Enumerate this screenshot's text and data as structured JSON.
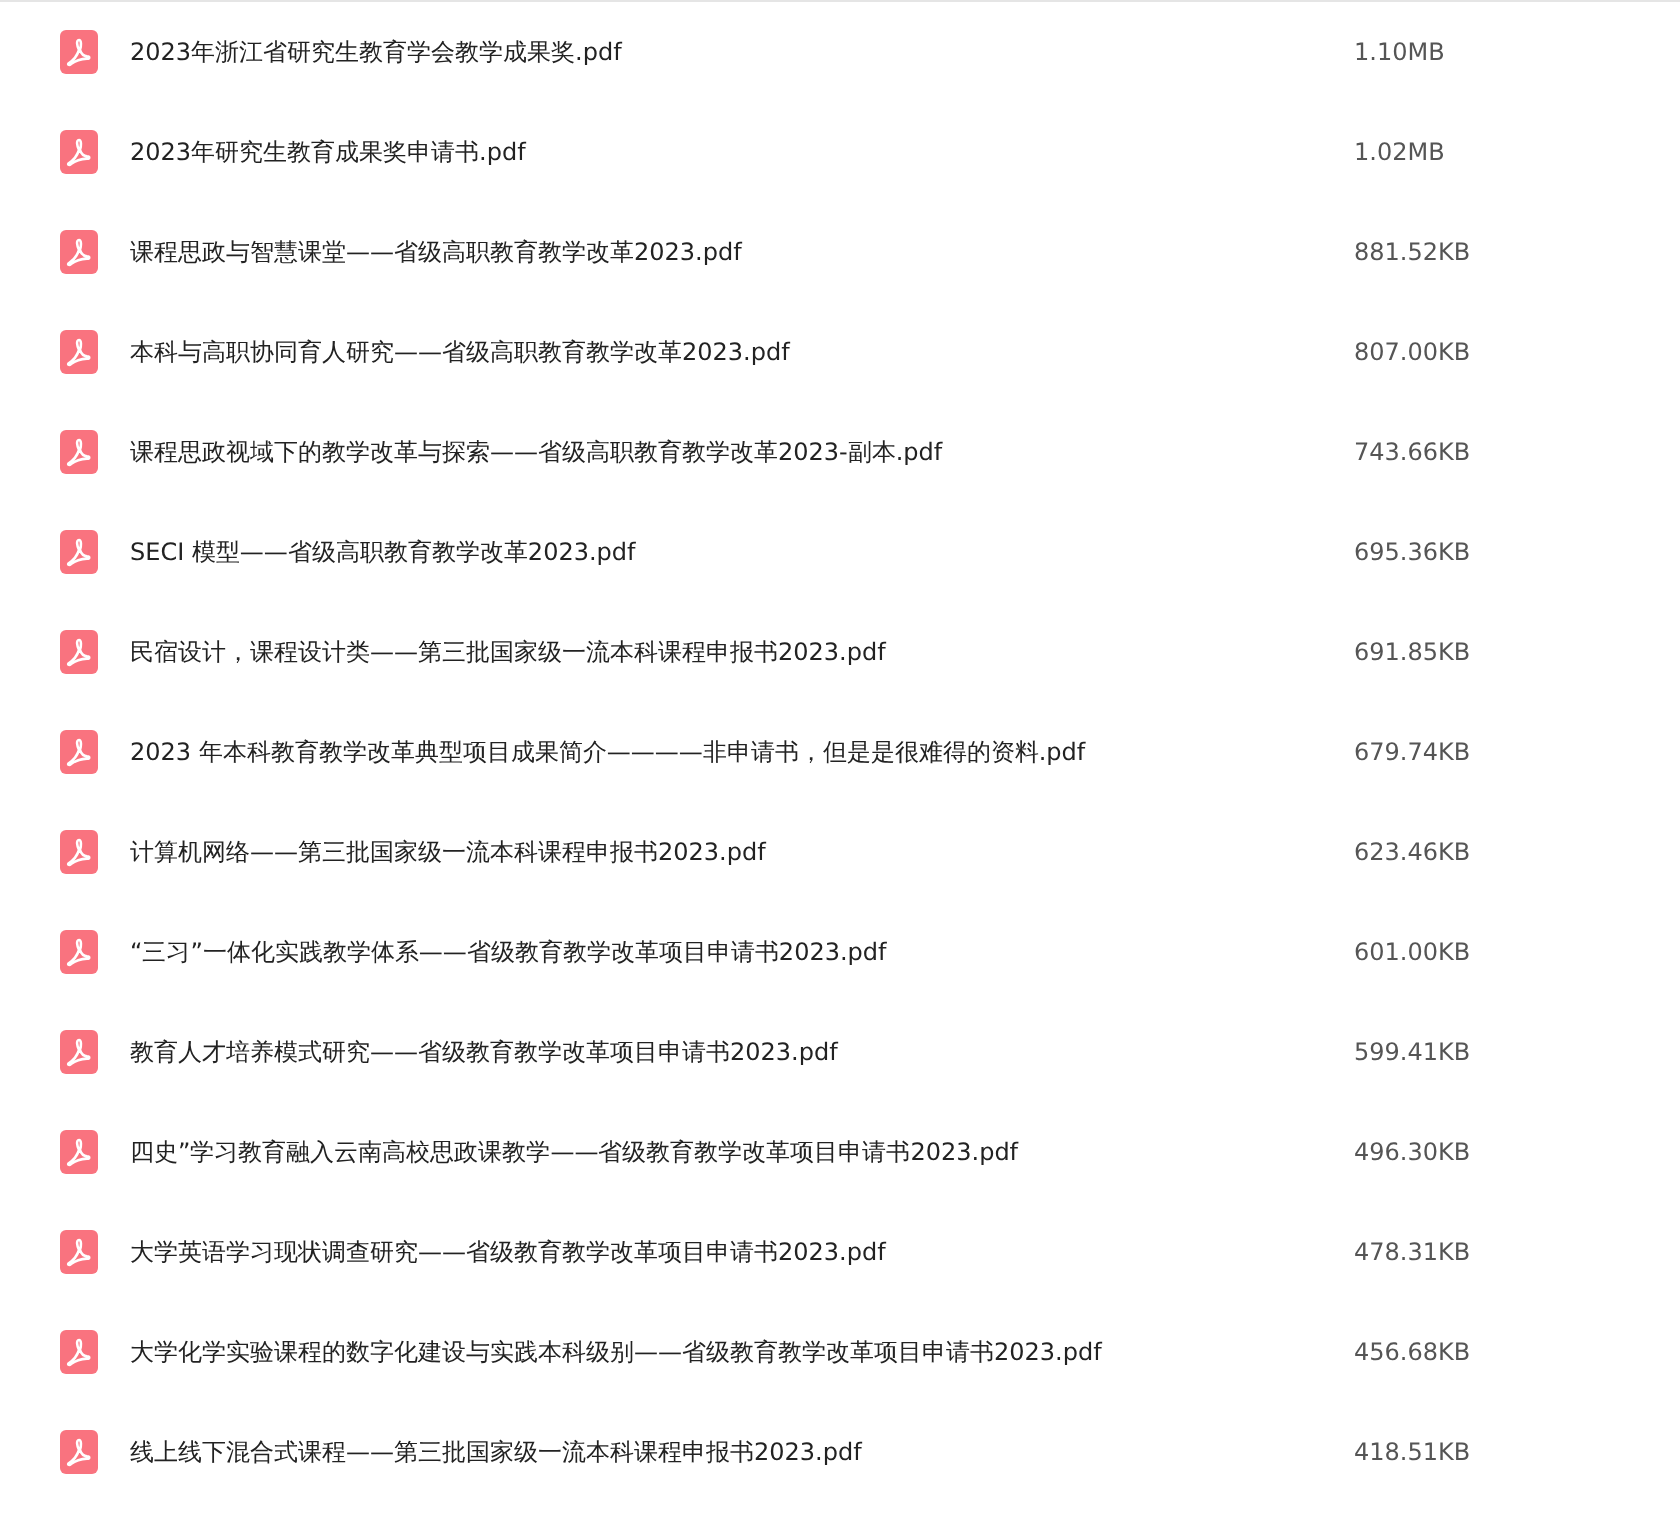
{
  "files": [
    {
      "name": "2023年浙江省研究生教育学会教学成果奖.pdf",
      "size": "1.10MB"
    },
    {
      "name": "2023年研究生教育成果奖申请书.pdf",
      "size": "1.02MB"
    },
    {
      "name": "课程思政与智慧课堂——省级高职教育教学改革2023.pdf",
      "size": "881.52KB"
    },
    {
      "name": "本科与高职协同育人研究——省级高职教育教学改革2023.pdf",
      "size": "807.00KB"
    },
    {
      "name": "课程思政视域下的教学改革与探索——省级高职教育教学改革2023-副本.pdf",
      "size": "743.66KB"
    },
    {
      "name": "SECI 模型——省级高职教育教学改革2023.pdf",
      "size": "695.36KB"
    },
    {
      "name": "民宿设计，课程设计类——第三批国家级一流本科课程申报书2023.pdf",
      "size": "691.85KB"
    },
    {
      "name": "2023 年本科教育教学改革典型项目成果简介————非申请书，但是是很难得的资料.pdf",
      "size": "679.74KB"
    },
    {
      "name": "计算机网络——第三批国家级一流本科课程申报书2023.pdf",
      "size": "623.46KB"
    },
    {
      "name": "“三习”一体化实践教学体系——省级教育教学改革项目申请书2023.pdf",
      "size": "601.00KB"
    },
    {
      "name": "教育人才培养模式研究——省级教育教学改革项目申请书2023.pdf",
      "size": "599.41KB"
    },
    {
      "name": "四史”学习教育融入云南高校思政课教学——省级教育教学改革项目申请书2023.pdf",
      "size": "496.30KB"
    },
    {
      "name": "大学英语学习现状调查研究——省级教育教学改革项目申请书2023.pdf",
      "size": "478.31KB"
    },
    {
      "name": "大学化学实验课程的数字化建设与实践本科级别——省级教育教学改革项目申请书2023.pdf",
      "size": "456.68KB"
    },
    {
      "name": "线上线下混合式课程——第三批国家级一流本科课程申报书2023.pdf",
      "size": "418.51KB"
    }
  ]
}
